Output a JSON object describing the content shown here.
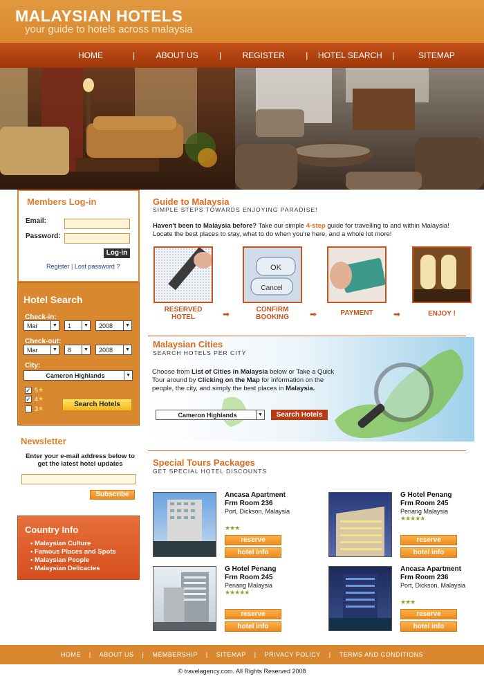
{
  "header": {
    "title": "MALAYSIAN HOTELS",
    "subtitle": "your guide to hotels across malaysia"
  },
  "nav": {
    "items": [
      "HOME",
      "ABOUT US",
      "REGISTER",
      "HOTEL SEARCH",
      "SITEMAP"
    ],
    "separator": "|"
  },
  "login": {
    "title": "Members Log-in",
    "email_label": "Email:",
    "password_label": "Password:",
    "login_button": "Log-in",
    "register_link": "Register",
    "lost_password_link": "Lost password ?",
    "separator": "|"
  },
  "hotel_search": {
    "title": "Hotel Search",
    "checkin_label": "Check-in:",
    "checkin": {
      "month": "Mar",
      "day": "1",
      "year": "2008"
    },
    "checkout_label": "Check-out:",
    "checkout": {
      "month": "Mar",
      "day": "8",
      "year": "2008"
    },
    "city_label": "City:",
    "city_value": "Cameron Highlands",
    "star_filters": [
      {
        "value": "5",
        "checked": true
      },
      {
        "value": "4",
        "checked": true
      },
      {
        "value": "3",
        "checked": false
      }
    ],
    "search_button": "Search Hotels"
  },
  "newsletter": {
    "title": "Newsletter",
    "text": "Enter your e-mail address below to get the latest hotel updates",
    "subscribe_button": "Subscribe"
  },
  "country_info": {
    "title": "Country Info",
    "items": [
      "Malaysian Culture",
      "Famous Places and Spots",
      "Malaysian People",
      "Malaysian Delicacies"
    ]
  },
  "guide": {
    "title": "Guide to Malaysia",
    "subtitle": "SIMPLE STEPS TOWARDS ENJOYING PARADISE!",
    "intro_bold": "Haven't been to Malaysia before?",
    "intro_pre": " Take our simple ",
    "intro_highlight": "4-step",
    "intro_post": " guide for travelling to and within Malaysia! Locate the best places to stay, what to do when you're here, and a whole lot more!",
    "steps": [
      "RESERVED HOTEL",
      "CONFIRM BOOKING",
      "PAYMENT",
      "ENJOY !"
    ],
    "ok_label": "OK",
    "cancel_label": "Cancel"
  },
  "cities": {
    "title": "Malaysian Cities",
    "subtitle": "SEARCH HOTELS PER CITY",
    "t1": "Choose from ",
    "b1": "List of Cities in Malaysia",
    "t2": " below or Take a Quick Tour  around by ",
    "b2": "Clicking on the Map",
    "t3": " for information on  the people, the city, and simply the best places in ",
    "b3": "Malaysia.",
    "city_value": "Cameron Highlands",
    "search_button": "Search Hotels"
  },
  "tours": {
    "title": "Special Tours Packages",
    "subtitle": "GET SPECIAL HOTEL DISCOUNTS",
    "hotels": [
      {
        "name": "Ancasa Apartment",
        "room": "Frm Room 236",
        "location": "Port, Dickson, Malaysia",
        "stars": "★★★"
      },
      {
        "name": "G Hotel Penang",
        "room": "Frm Room 245",
        "location": "Penang Malaysia",
        "stars": "★★★★★"
      },
      {
        "name": "G Hotel Penang",
        "room": "Frm Room 245",
        "location": "Penang Malaysia",
        "stars": "★★★★★"
      },
      {
        "name": "Ancasa Apartment",
        "room": "Frm Room 236",
        "location": "Port, Dickson, Malaysia",
        "stars": "★★★"
      }
    ],
    "reserve_label": "reserve",
    "info_label": "hotel info"
  },
  "footer": {
    "links": [
      "HOME",
      "ABOUT US",
      "MEMBERSHIP",
      "SITEMAP",
      "PRIVACY POLICY",
      "TERMS AND CONDITIONS"
    ],
    "separator": "|",
    "copyright": "© travelagency.com. All Rights Reserved 2008"
  },
  "colors": {
    "brand_orange": "#d9882f",
    "nav_red": "#b5420f",
    "accent": "#e06a1c"
  }
}
